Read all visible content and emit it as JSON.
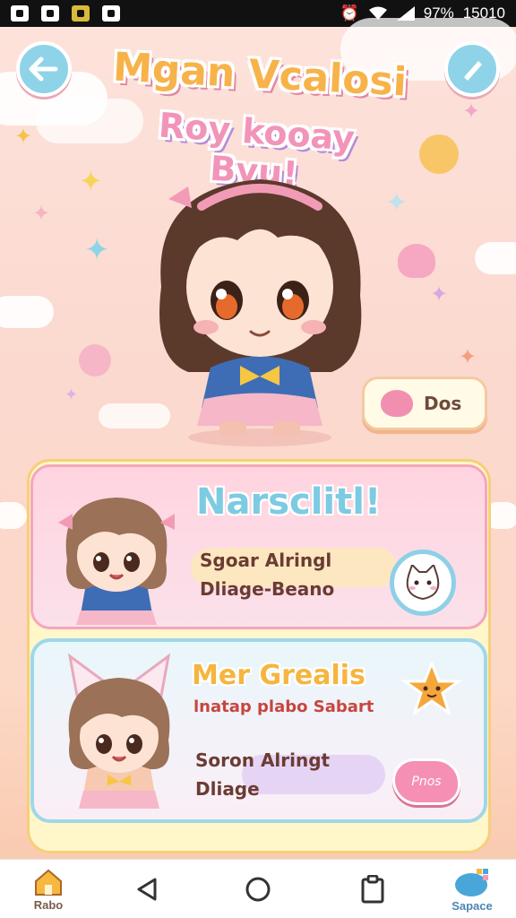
{
  "status_bar": {
    "battery": "97%",
    "time": "15010"
  },
  "header": {
    "title": "Mgan Vcalosi",
    "subtitle": "Roy kooay Byu!",
    "back_icon": "back-arrow-icon",
    "edit_icon": "pencil-icon"
  },
  "hero": {
    "dos_label": "Dos"
  },
  "cards": [
    {
      "title": "Narsclitl!",
      "line1": "Sgoar Alringl",
      "line2": "Dliage-Beano",
      "action_icon": "cat-face-icon"
    },
    {
      "title": "Mer Grealis",
      "subtitle": "lnatap plabo Sabart",
      "line1": "Soron Alringt",
      "line2": "Dliage",
      "badge_icon": "star-face-icon",
      "action_label": "Pnos"
    }
  ],
  "nav": {
    "home_label": "Rabo",
    "space_label": "Sapace"
  },
  "colors": {
    "accent_blue": "#8fd3e8",
    "accent_pink": "#f28fb0",
    "accent_yellow": "#f7b34a",
    "text_brown": "#6b3c33"
  }
}
